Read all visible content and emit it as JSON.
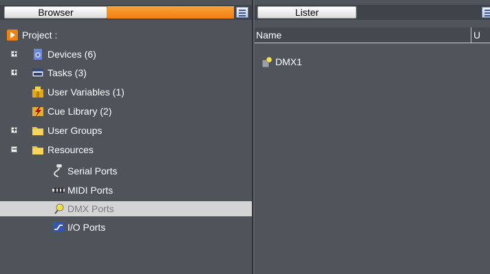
{
  "browser": {
    "tab_label": "Browser",
    "menu_icon": "list-menu-icon",
    "items": [
      {
        "label": "Project :",
        "icon": "project-arrow-icon",
        "expander": ""
      },
      {
        "label": "Devices (6)",
        "icon": "devices-gear-icon",
        "expander": "+"
      },
      {
        "label": "Tasks (3)",
        "icon": "tasks-window-icon",
        "expander": "+"
      },
      {
        "label": "User Variables (1)",
        "icon": "user-variables-icon",
        "expander": ""
      },
      {
        "label": "Cue Library (2)",
        "icon": "cue-library-icon",
        "expander": ""
      },
      {
        "label": "User Groups",
        "icon": "folder-icon",
        "expander": "+"
      },
      {
        "label": "Resources",
        "icon": "folder-icon",
        "expander": "−"
      },
      {
        "label": "Serial Ports",
        "icon": "serial-port-icon",
        "expander": ""
      },
      {
        "label": "MIDI Ports",
        "icon": "midi-port-icon",
        "expander": ""
      },
      {
        "label": "DMX Ports",
        "icon": "dmx-port-icon",
        "expander": ""
      },
      {
        "label": "I/O Ports",
        "icon": "io-port-icon",
        "expander": ""
      }
    ],
    "selected_item": "DMX Ports"
  },
  "lister": {
    "tab_label": "Lister",
    "menu_icon": "list-menu-icon",
    "columns": [
      "Name",
      "U"
    ],
    "rows": [
      {
        "name": "DMX1",
        "icon": "dmx-device-icon"
      }
    ]
  },
  "colors": {
    "accent_orange": "#f07f10",
    "panel_bg": "#4f545b",
    "selection_bg": "#d4d4d4"
  }
}
